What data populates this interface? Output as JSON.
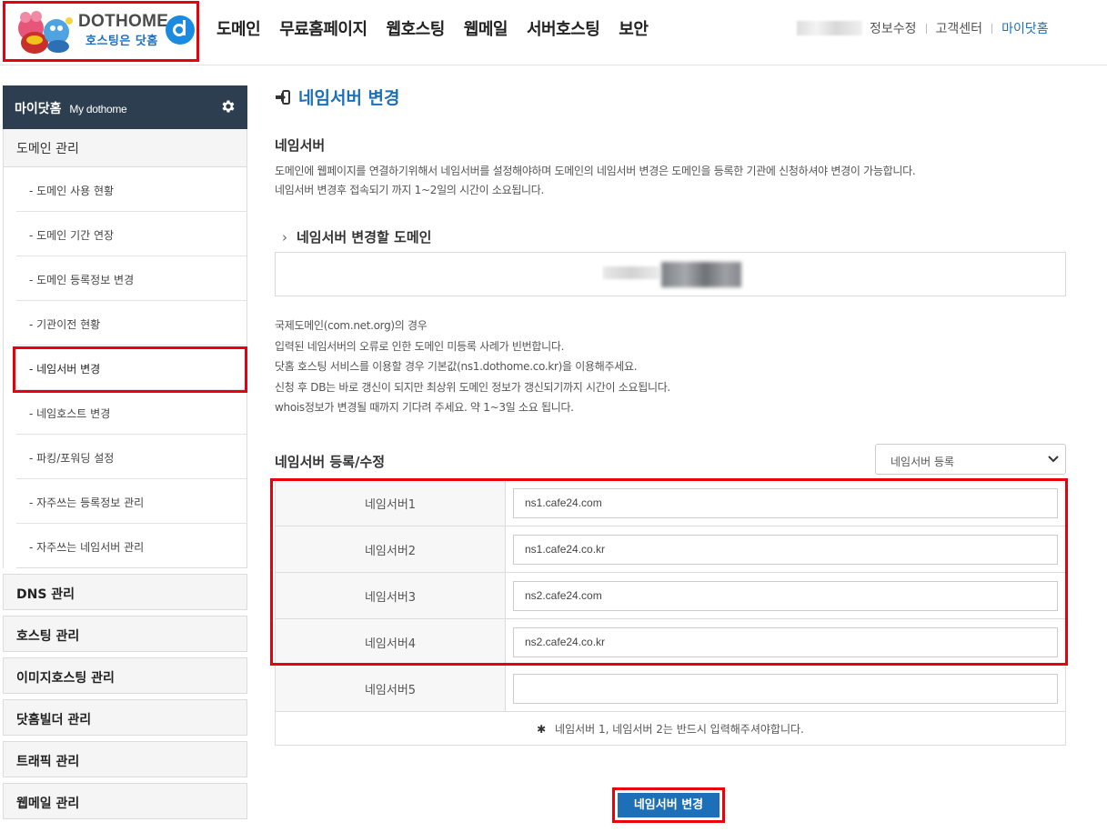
{
  "header": {
    "logo": {
      "brand": "DOTHOME",
      "slogan": "호스팅은 닷홈"
    },
    "nav": [
      "도메인",
      "무료홈페이지",
      "웹호스팅",
      "웹메일",
      "서버호스팅",
      "보안"
    ],
    "util": {
      "edit_profile": "정보수정",
      "support": "고객센터",
      "my_dothome": "마이닷홈"
    }
  },
  "sidebar": {
    "title": "마이닷홈",
    "title_en": "My dothome",
    "group_label": "도메인 관리",
    "items": [
      {
        "label": "- 도메인 사용 현황"
      },
      {
        "label": "- 도메인 기간 연장"
      },
      {
        "label": "- 도메인 등록정보 변경"
      },
      {
        "label": "- 기관이전 현황"
      },
      {
        "label": "- 네임서버 변경"
      },
      {
        "label": "- 네임호스트 변경"
      },
      {
        "label": "- 파킹/포워딩 설정"
      },
      {
        "label": "- 자주쓰는 등록정보 관리"
      },
      {
        "label": "- 자주쓰는 네임서버 관리"
      }
    ],
    "categories": [
      "DNS 관리",
      "호스팅 관리",
      "이미지호스팅 관리",
      "닷홈빌더 관리",
      "트래픽 관리",
      "웹메일 관리"
    ]
  },
  "main": {
    "page_title": "네임서버 변경",
    "section_title": "네임서버",
    "desc_lines": [
      "도메인에 웹페이지를 연결하기위해서 네임서버를 설정해야하며 도메인의 네임서버 변경은 도메인을 등록한 기관에 신청하셔야 변경이 가능합니다.",
      "네임서버 변경후 접속되기 까지 1~2일의 시간이 소요됩니다."
    ],
    "domain_label": "네임서버 변경할 도메인",
    "notice_lines": [
      "국제도메인(com.net.org)의 경우",
      "입력된 네임서버의 오류로 인한 도메인 미등록 사례가 빈번합니다.",
      "닷홈 호스팅 서비스를 이용할 경우 기본값(ns1.dothome.co.kr)을 이용해주세요.",
      "신청 후 DB는 바로 갱신이 되지만 최상위 도메인 정보가 갱신되기까지 시간이 소요됩니다.",
      "whois정보가 변경될 때까지 기다려 주세요. 약 1~3일 소요 됩니다."
    ],
    "register_title": "네임서버 등록/수정",
    "register_select": "네임서버 등록",
    "nameservers": [
      {
        "label": "네임서버1",
        "value": "ns1.cafe24.com"
      },
      {
        "label": "네임서버2",
        "value": "ns1.cafe24.co.kr"
      },
      {
        "label": "네임서버3",
        "value": "ns2.cafe24.com"
      },
      {
        "label": "네임서버4",
        "value": "ns2.cafe24.co.kr"
      },
      {
        "label": "네임서버5",
        "value": ""
      }
    ],
    "required_note": "네임서버 1, 네임서버 2는 반드시 입력해주셔야합니다.",
    "submit_label": "네임서버 변경"
  },
  "colors": {
    "accent": "#1d6fb7",
    "highlight": "#e8000b",
    "sidebar_head": "#2c3e50"
  }
}
